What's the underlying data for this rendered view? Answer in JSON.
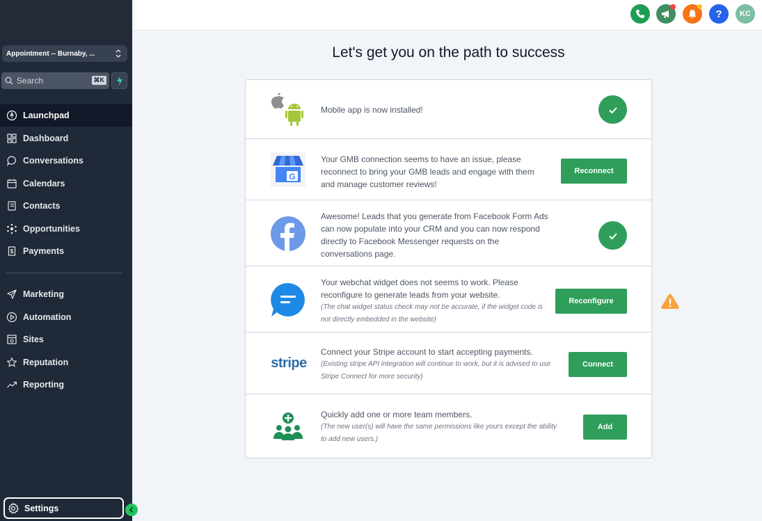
{
  "sidebar": {
    "location": "Appointment -- Burnaby, ...",
    "search_placeholder": "Search",
    "search_shortcut": "⌘K",
    "items": [
      {
        "label": "Launchpad",
        "icon": "launchpad-icon",
        "active": true
      },
      {
        "label": "Dashboard",
        "icon": "dashboard-icon"
      },
      {
        "label": "Conversations",
        "icon": "chat-icon"
      },
      {
        "label": "Calendars",
        "icon": "calendar-icon"
      },
      {
        "label": "Contacts",
        "icon": "contacts-icon"
      },
      {
        "label": "Opportunities",
        "icon": "opportunities-icon"
      },
      {
        "label": "Payments",
        "icon": "payments-icon"
      }
    ],
    "items2": [
      {
        "label": "Marketing",
        "icon": "send-icon"
      },
      {
        "label": "Automation",
        "icon": "automation-icon"
      },
      {
        "label": "Sites",
        "icon": "sites-icon"
      },
      {
        "label": "Reputation",
        "icon": "star-icon"
      },
      {
        "label": "Reporting",
        "icon": "trend-icon"
      }
    ],
    "settings": "Settings"
  },
  "topbar": {
    "avatar": "KC",
    "colors": {
      "phone": "#1e9e55",
      "announce": "#3f8f62",
      "bell": "#f97316",
      "help": "#2563eb",
      "avatar": "#7bbfa4"
    }
  },
  "main": {
    "title": "Let's get you on the path to success",
    "rows": [
      {
        "text": "Mobile app is now installed!",
        "status": "done"
      },
      {
        "text": "Your GMB connection seems to have an issue, please reconnect to bring your GMB leads and engage with them and manage customer reviews!",
        "button": "Reconnect"
      },
      {
        "text": "Awesome! Leads that you generate from Facebook Form Ads can now populate into your CRM and you can now respond directly to Facebook Messenger requests on the conversations page.",
        "status": "done"
      },
      {
        "text": "Your webchat widget does not seems to work. Please reconfigure to generate leads from your website.",
        "note": "(The chat widget status check may not be accurate, if the widget code is not directly embedded in the website)",
        "button": "Reconfigure"
      },
      {
        "text": "Connect your Stripe account to start accepting payments.",
        "note": "(Existing stripe API integration will continue to work, but it is advised to use Stripe Connect for more security)",
        "button": "Connect",
        "logo_text": "stripe"
      },
      {
        "text": "Quickly add one or more team members.",
        "note": "(The new user(s) will have the same permissions like yours except the ability to add new users.)",
        "button": "Add"
      }
    ]
  }
}
